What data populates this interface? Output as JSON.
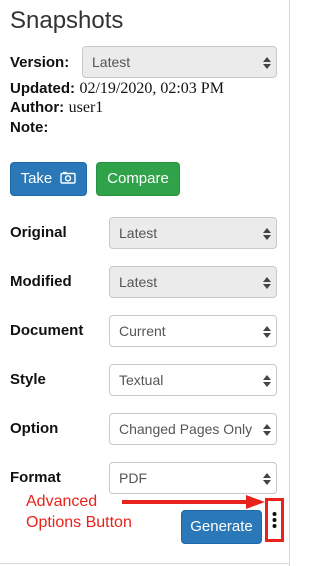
{
  "panel": {
    "title": "Snapshots",
    "version_label": "Version:",
    "version_value": "Latest",
    "updated_label": "Updated:",
    "updated_value": "02/19/2020, 02:03 PM",
    "author_label": "Author:",
    "author_value": "user1",
    "note_label": "Note:",
    "note_value": ""
  },
  "actions": {
    "take_label": "Take",
    "take_icon": "camera-icon",
    "compare_label": "Compare",
    "take_color": "#2a78b8",
    "compare_color": "#2fa24a"
  },
  "fields": [
    {
      "label": "Original",
      "value": "Latest",
      "disabled": true
    },
    {
      "label": "Modified",
      "value": "Latest",
      "disabled": true
    },
    {
      "label": "Document",
      "value": "Current",
      "disabled": false
    },
    {
      "label": "Style",
      "value": "Textual",
      "disabled": false
    },
    {
      "label": "Option",
      "value": "Changed Pages Only",
      "disabled": false
    },
    {
      "label": "Format",
      "value": "PDF",
      "disabled": false
    }
  ],
  "footer": {
    "generate_label": "Generate",
    "more_icon": "kebab-menu-icon"
  },
  "annotation": {
    "line1": "Advanced",
    "line2": "Options Button",
    "color": "#e8231b"
  }
}
